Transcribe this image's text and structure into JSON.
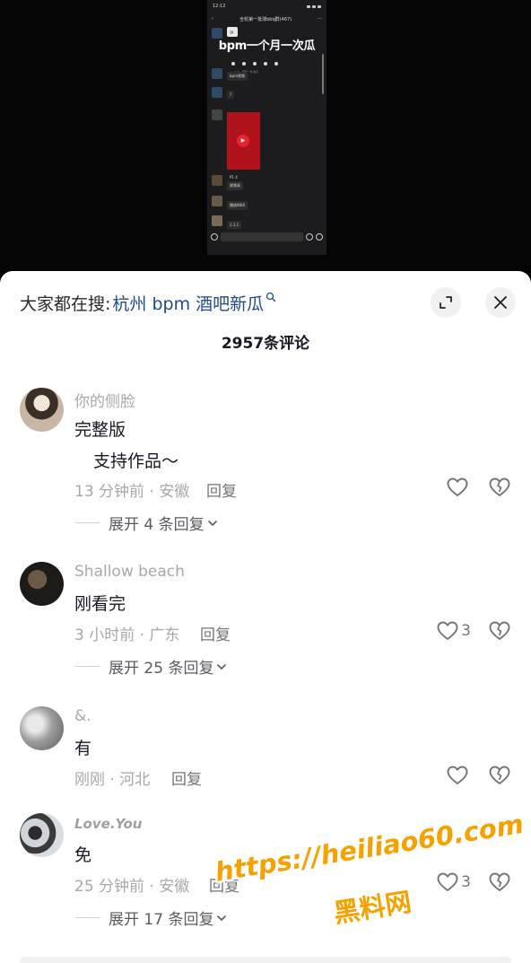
{
  "video": {
    "status_time": "12:12",
    "chat_title": "全杭第一批球bbq群(467)",
    "first_bubble": "@.",
    "banner": "bpm一个月一次瓜",
    "sub_caption": "以上 · 展开一条消息",
    "messages": [
      "bpm视频",
      "?",
      "P1 4",
      "视频录",
      "播放88印",
      "1.1.1"
    ]
  },
  "search": {
    "label": "大家都在搜:",
    "term": "杭州 bpm 酒吧新瓜"
  },
  "comment_count": "2957条评论",
  "comments": [
    {
      "username": "你的侧脸",
      "text": "完整版",
      "text2": "支持作品～",
      "meta": "13 分钟前 · 安徽",
      "reply": "回复",
      "likes": "",
      "expand": "展开 4 条回复"
    },
    {
      "username": "Shallow beach",
      "text": "刚看完",
      "meta": "3 小时前 · 广东",
      "reply": "回复",
      "likes": "3",
      "expand": "展开 25 条回复"
    },
    {
      "username": "&.",
      "text": "有",
      "meta": "刚刚 · 河北",
      "reply": "回复",
      "likes": ""
    },
    {
      "username": "Love.You",
      "text": "免",
      "meta": "25 分钟前 · 安徽",
      "reply": "回复",
      "likes": "3",
      "expand": "展开 17 条回复"
    }
  ],
  "watermark": {
    "line1": "https://heiliao60.com",
    "line2": "黑料网"
  },
  "colors": {
    "search_term": "#1f4a86",
    "watermark": "#f5a100",
    "sheet_bg": "#ffffff",
    "muted": "#a7a8ac"
  }
}
